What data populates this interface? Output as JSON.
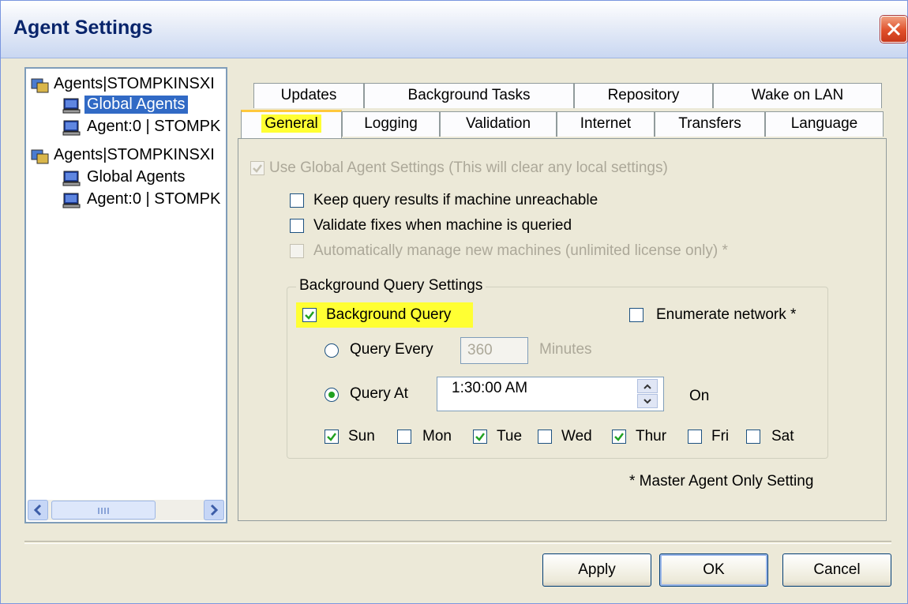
{
  "window": {
    "title": "Agent Settings"
  },
  "tree": {
    "items": [
      {
        "label": "Agents|STOMPKINSXI"
      },
      {
        "label": "Global Agents"
      },
      {
        "label": "Agent:0 | STOMPK"
      },
      {
        "label": "Agents|STOMPKINSXI"
      },
      {
        "label": "Global Agents"
      },
      {
        "label": "Agent:0 | STOMPK"
      }
    ]
  },
  "tabs": {
    "row1": [
      "Updates",
      "Background Tasks",
      "Repository",
      "Wake on LAN"
    ],
    "row2": [
      "General",
      "Logging",
      "Validation",
      "Internet",
      "Transfers",
      "Language"
    ],
    "active": "General"
  },
  "general": {
    "use_global": "Use Global Agent Settings (This will clear any local settings)",
    "keep_results": "Keep query results if machine unreachable",
    "validate_fixes": "Validate fixes when machine is queried",
    "auto_manage": "Automatically manage new machines (unlimited license only)  *",
    "group_title": "Background Query Settings",
    "background_query": "Background Query",
    "enumerate_network": "Enumerate network *",
    "query_every": "Query Every",
    "query_every_value": "360",
    "minutes": "Minutes",
    "query_at": "Query At",
    "query_at_value": "1:30:00 AM",
    "on": "On",
    "days": [
      {
        "label": "Sun",
        "checked": true
      },
      {
        "label": "Mon",
        "checked": false
      },
      {
        "label": "Tue",
        "checked": true
      },
      {
        "label": "Wed",
        "checked": false
      },
      {
        "label": "Thur",
        "checked": true
      },
      {
        "label": "Fri",
        "checked": false
      },
      {
        "label": "Sat",
        "checked": false
      }
    ],
    "footnote": "* Master Agent Only Setting"
  },
  "buttons": {
    "apply": "Apply",
    "ok": "OK",
    "cancel": "Cancel"
  },
  "colors": {
    "highlight": "#ffff33",
    "selection": "#316ac5"
  }
}
